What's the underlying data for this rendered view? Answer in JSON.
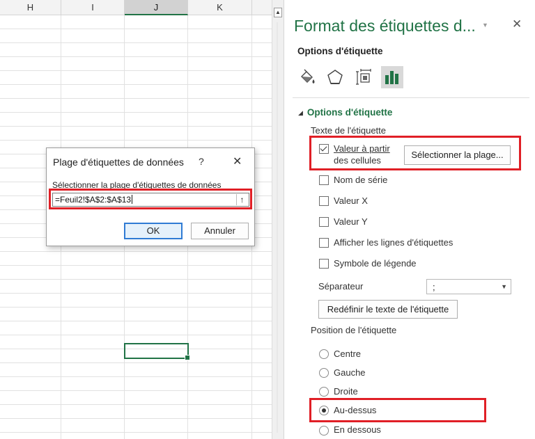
{
  "sheet": {
    "columns": [
      {
        "label": "H",
        "selected": false
      },
      {
        "label": "I",
        "selected": false
      },
      {
        "label": "J",
        "selected": true
      },
      {
        "label": "K",
        "selected": false
      }
    ]
  },
  "pane": {
    "title": "Format des étiquettes d...",
    "menu_glyph": "▼",
    "close_glyph": "✕",
    "subtitle": "Options d'étiquette",
    "tabs": [
      {
        "name": "fill-line",
        "icon": "paint-bucket-icon",
        "active": false
      },
      {
        "name": "effects",
        "icon": "pentagon-icon",
        "active": false
      },
      {
        "name": "size-properties",
        "icon": "size-properties-icon",
        "active": false
      },
      {
        "name": "label-options",
        "icon": "bar-chart-icon",
        "active": true
      }
    ],
    "section_title": "Options d'étiquette",
    "label_contains_heading": "Texte de l'étiquette",
    "checkboxes": {
      "value_from_cells_line1": "Valeur à partir",
      "value_from_cells_line2": "des cellules",
      "value_from_cells_checked": true,
      "series_name": "Nom de série",
      "value_x": "Valeur X",
      "value_y": "Valeur Y",
      "leader_lines": "Afficher les lignes d'étiquettes",
      "legend_key": "Symbole de légende"
    },
    "select_range_button": "Sélectionner la plage...",
    "separator_label": "Séparateur",
    "separator_value": ";",
    "reset_button": "Redéfinir le texte de l'étiquette",
    "position_heading": "Position de l'étiquette",
    "positions": [
      "Centre",
      "Gauche",
      "Droite",
      "Au-dessus",
      "En dessous"
    ],
    "selected_position": "Au-dessus"
  },
  "dialog": {
    "title": "Plage d'étiquettes de données",
    "help_glyph": "?",
    "close_glyph": "✕",
    "field_label": "Sélectionner la plage d'étiquettes de données",
    "field_value": "=Feuil2!$A$2:$A$13",
    "collapse_glyph": "🡅",
    "ok_label": "OK",
    "cancel_label": "Annuler"
  },
  "colors": {
    "accent_green": "#217346",
    "highlight_red": "#e01f26"
  }
}
